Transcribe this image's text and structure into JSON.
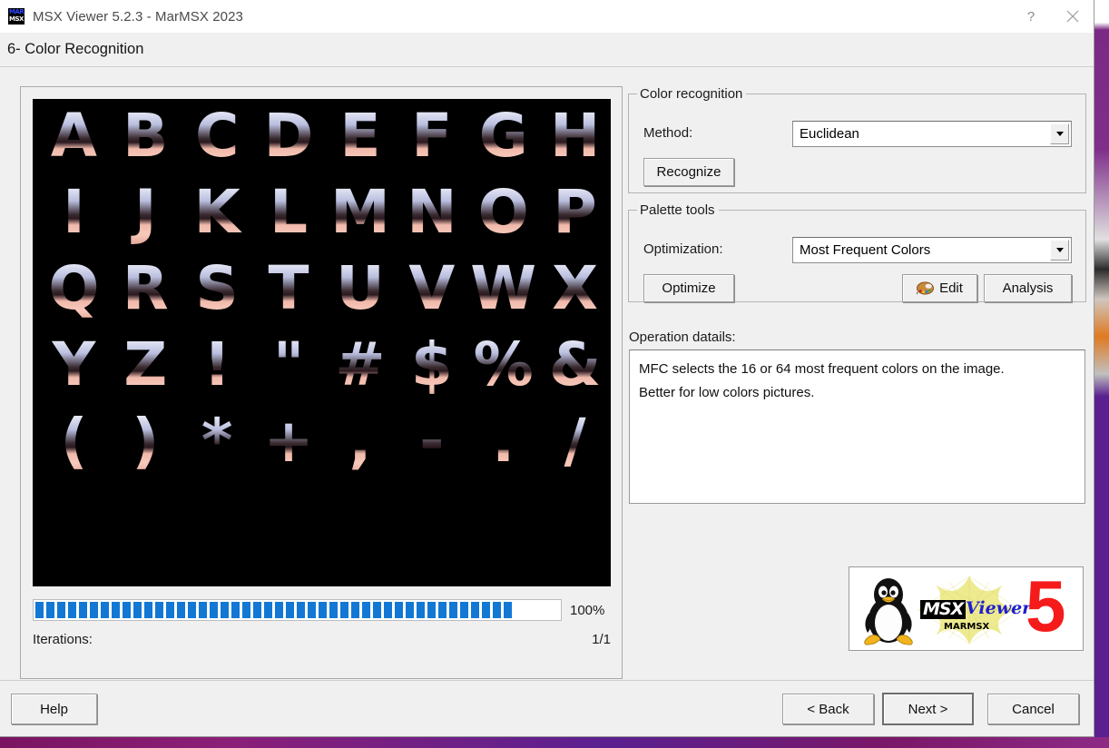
{
  "window": {
    "title": "MSX Viewer 5.2.3 - MarMSX 2023",
    "app_icon_line1": "MAR",
    "app_icon_line2": "MSX",
    "help_button": "?",
    "close_button": "✕"
  },
  "header": {
    "step_title": "6- Color Recognition"
  },
  "preview": {
    "glyph_rows": [
      "ABCDEFGH",
      "IJKLMNOP",
      "QRSTUVWX",
      "YZ!\"#$%&",
      "()*+,-./"
    ],
    "background_color": "#000000"
  },
  "progress": {
    "percent_label": "100%",
    "value": 100,
    "segments": 44,
    "bar_color": "#1278d4",
    "iterations_label": "Iterations:",
    "iterations_value": "1/1"
  },
  "color_recognition": {
    "legend": "Color recognition",
    "method_label": "Method:",
    "method_value": "Euclidean",
    "method_options": [
      "Euclidean"
    ],
    "recognize_button": "Recognize"
  },
  "palette_tools": {
    "legend": "Palette tools",
    "optimization_label": "Optimization:",
    "optimization_value": "Most Frequent Colors",
    "optimization_options": [
      "Most Frequent Colors"
    ],
    "optimize_button": "Optimize",
    "edit_button": "Edit",
    "edit_icon": "palette-icon",
    "analysis_button": "Analysis"
  },
  "operation": {
    "label": "Operation datails:",
    "line1": "MFC selects the 16 or 64 most frequent colors on the image.",
    "line2": "Better for low colors pictures."
  },
  "logo": {
    "msx_word": "MSX",
    "viewer_word": "Viewer",
    "marmsx_word": "MARMSX",
    "version_number": "5",
    "penguin_icon": "linux-penguin-icon"
  },
  "footer": {
    "help_button": "Help",
    "back_button": "< Back",
    "next_button": "Next >",
    "cancel_button": "Cancel"
  },
  "colors": {
    "accent_blue": "#1278d4",
    "window_bg": "#f0f0f0",
    "desktop_purple": "#5a2090",
    "logo_red": "#f51b1b",
    "viewer_blue": "#1f1fd0"
  }
}
